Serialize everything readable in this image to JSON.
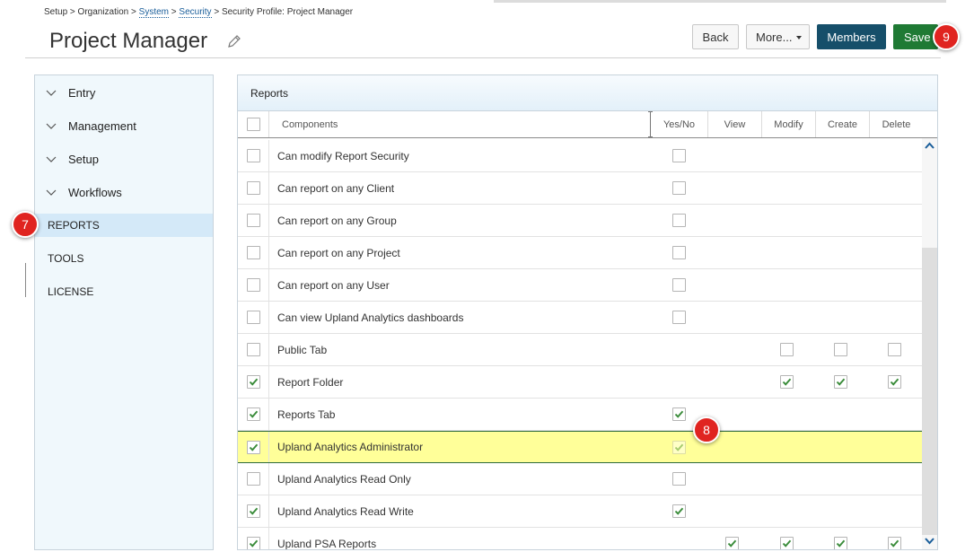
{
  "breadcrumb": {
    "setup": "Setup",
    "organization": "Organization",
    "system": "System",
    "security": "Security",
    "profile": "Security Profile: Project Manager",
    "sep": ">"
  },
  "page_title": "Project Manager",
  "toolbar": {
    "back_label": "Back",
    "more_label": "More...",
    "members_label": "Members",
    "save_label": "Save"
  },
  "markers": {
    "m7": "7",
    "m8": "8",
    "m9": "9"
  },
  "sidebar": {
    "items": [
      {
        "label": "Entry",
        "expandable": true
      },
      {
        "label": "Management",
        "expandable": true
      },
      {
        "label": "Setup",
        "expandable": true
      },
      {
        "label": "Workflows",
        "expandable": true
      },
      {
        "label": "REPORTS",
        "expandable": false,
        "active": true
      },
      {
        "label": "TOOLS",
        "expandable": false
      },
      {
        "label": "LICENSE",
        "expandable": false
      }
    ]
  },
  "panel": {
    "title": "Reports",
    "columns": {
      "components": "Components",
      "yesno": "Yes/No",
      "view": "View",
      "modify": "Modify",
      "create": "Create",
      "delete": "Delete"
    },
    "rows": [
      {
        "label": "Can modify Report Security",
        "selected": false,
        "yesno": false
      },
      {
        "label": "Can report on any Client",
        "selected": false,
        "yesno": false
      },
      {
        "label": "Can report on any Group",
        "selected": false,
        "yesno": false
      },
      {
        "label": "Can report on any Project",
        "selected": false,
        "yesno": false
      },
      {
        "label": "Can report on any User",
        "selected": false,
        "yesno": false
      },
      {
        "label": "Can view Upland Analytics dashboards",
        "selected": false,
        "yesno": false
      },
      {
        "label": "Public Tab",
        "selected": false,
        "modify": false,
        "create": false,
        "delete": false
      },
      {
        "label": "Report Folder",
        "selected": true,
        "modify": true,
        "create": true,
        "delete": true
      },
      {
        "label": "Reports Tab",
        "selected": true,
        "yesno": true
      },
      {
        "label": "Upland Analytics Administrator",
        "selected": true,
        "yesno": true,
        "highlighted": true
      },
      {
        "label": "Upland Analytics Read Only",
        "selected": false,
        "yesno": false
      },
      {
        "label": "Upland Analytics Read Write",
        "selected": true,
        "yesno": true
      },
      {
        "label": "Upland PSA Reports",
        "selected": true,
        "view": true,
        "modify": true,
        "create": true,
        "delete": true
      }
    ]
  },
  "colors": {
    "members_button": "#164f6a",
    "save_button": "#1f7a34",
    "marker": "#e02420",
    "highlight_row": "#ffff99",
    "check": "#3a8c3a"
  }
}
